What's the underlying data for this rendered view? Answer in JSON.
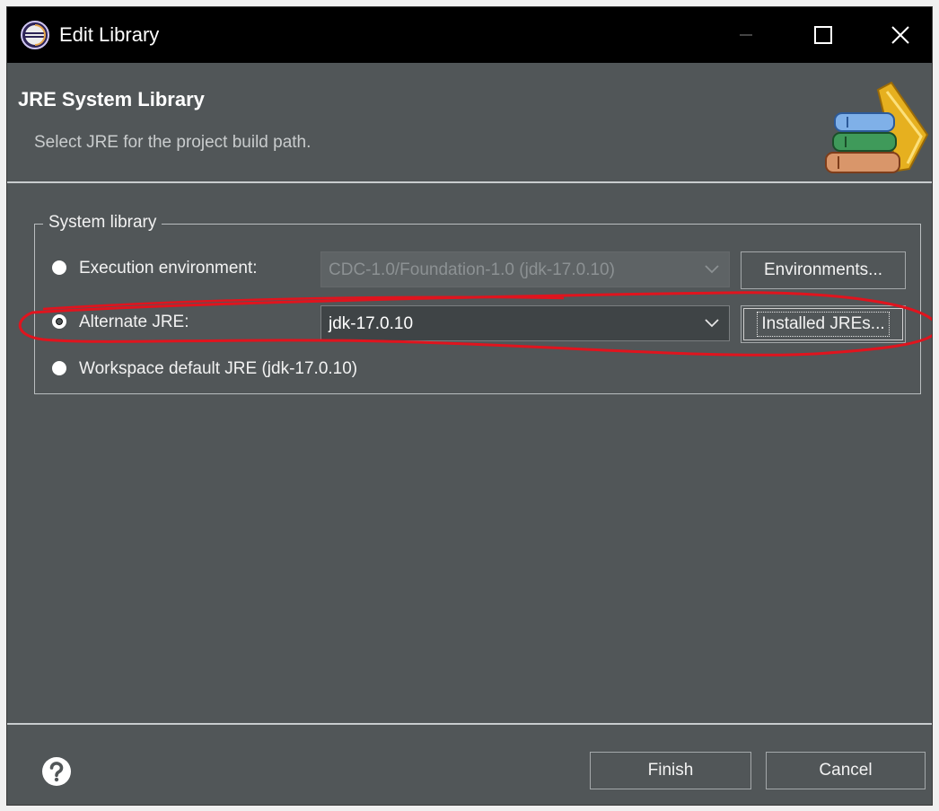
{
  "window": {
    "title": "Edit Library"
  },
  "header": {
    "title": "JRE System Library",
    "subtitle": "Select JRE for the project build path."
  },
  "group": {
    "legend": "System library",
    "options": {
      "execution": {
        "label": "Execution environment:",
        "value": "CDC-1.0/Foundation-1.0 (jdk-17.0.10)",
        "button": "Environments..."
      },
      "alternate": {
        "label": "Alternate JRE:",
        "value": "jdk-17.0.10",
        "button": "Installed JREs..."
      },
      "workspace": {
        "label": "Workspace default JRE (jdk-17.0.10)"
      }
    }
  },
  "footer": {
    "finish": "Finish",
    "cancel": "Cancel"
  },
  "colors": {
    "dialog_bg": "#515658",
    "titlebar_bg": "#000000",
    "annotation": "#e0141e"
  }
}
